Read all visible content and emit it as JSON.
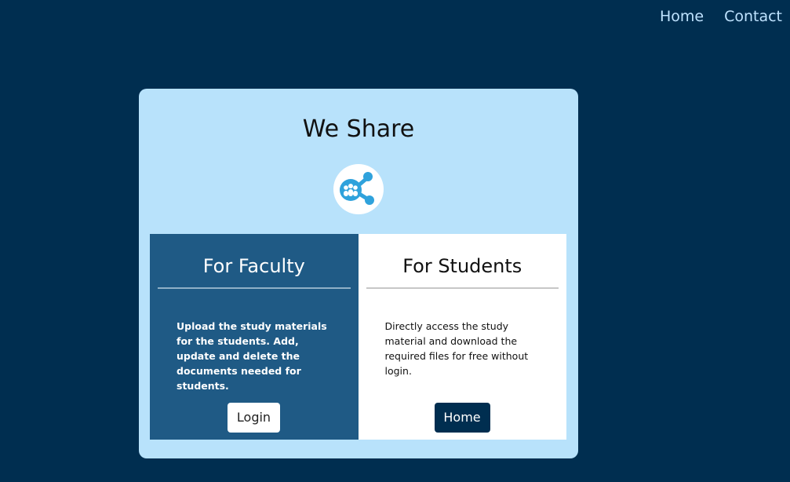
{
  "nav": {
    "home": "Home",
    "contact": "Contact"
  },
  "card": {
    "title": "We Share",
    "logo_icon": "share-network-icon"
  },
  "faculty": {
    "heading": "For Faculty",
    "description": "Upload the study materials for the students. Add, update and delete the documents needed for students.",
    "button": "Login"
  },
  "students": {
    "heading": "For Students",
    "description": "Directly access the study material and download the required files for free without login.",
    "button": "Home"
  },
  "colors": {
    "background": "#002e50",
    "card": "#b8e2fb",
    "faculty_panel": "#1f5a85",
    "nav_link": "#bfe3ff",
    "icon_blue": "#2fa2dc"
  }
}
